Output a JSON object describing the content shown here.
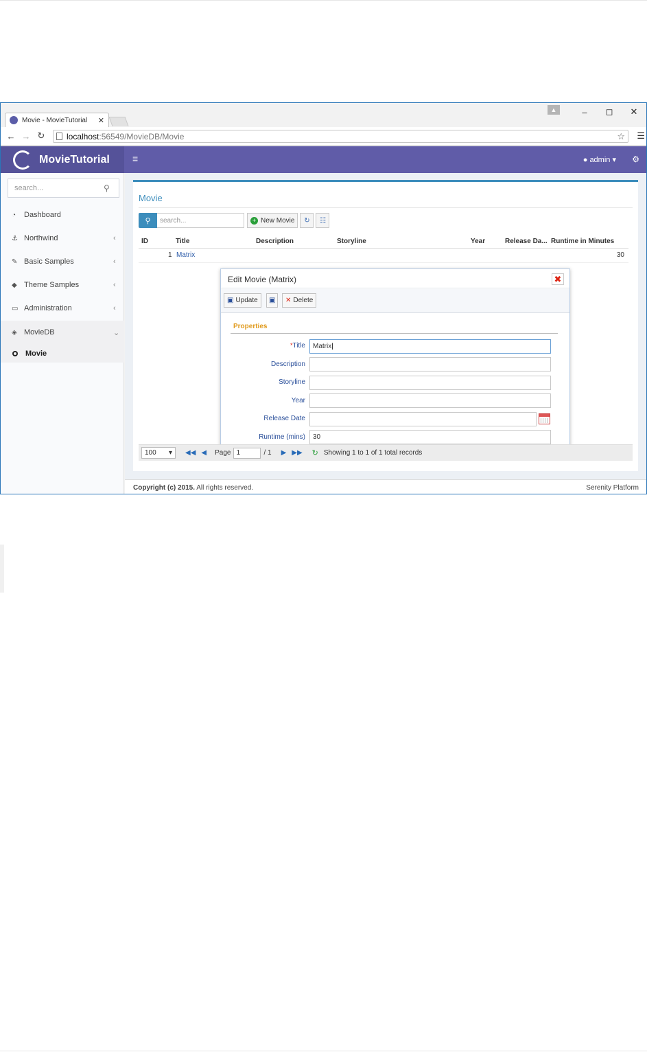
{
  "browser": {
    "tab_title": "Movie - MovieTutorial",
    "url_host": "localhost",
    "url_path": ":56549/MovieDB/Movie"
  },
  "header": {
    "app_name": "MovieTutorial",
    "user": "admin"
  },
  "sidebar": {
    "search_placeholder": "search...",
    "items": [
      {
        "label": "Dashboard",
        "icon": "dashboard-icon"
      },
      {
        "label": "Northwind",
        "icon": "anchor-icon"
      },
      {
        "label": "Basic Samples",
        "icon": "wrench-icon"
      },
      {
        "label": "Theme Samples",
        "icon": "diamond-icon"
      },
      {
        "label": "Administration",
        "icon": "monitor-icon"
      },
      {
        "label": "MovieDB",
        "icon": "cubes-icon"
      }
    ],
    "sub_item": "Movie"
  },
  "grid": {
    "title": "Movie",
    "search_placeholder": "search...",
    "new_button": "New Movie",
    "columns": [
      "ID",
      "Title",
      "Description",
      "Storyline",
      "Year",
      "Release Da...",
      "Runtime in Minutes"
    ],
    "rows": [
      {
        "id": "1",
        "title": "Matrix",
        "description": "",
        "storyline": "",
        "year": "",
        "release_date": "",
        "runtime": "30"
      }
    ],
    "pager": {
      "page_size": "100",
      "page_label": "Page",
      "page_value": "1",
      "page_total": "/ 1",
      "status": "Showing 1 to 1 of 1 total records"
    }
  },
  "dialog": {
    "title": "Edit Movie (Matrix)",
    "update_label": "Update",
    "delete_label": "Delete",
    "category": "Properties",
    "fields": [
      {
        "label": "Title",
        "value": "Matrix",
        "required": "*"
      },
      {
        "label": "Description",
        "value": ""
      },
      {
        "label": "Storyline",
        "value": ""
      },
      {
        "label": "Year",
        "value": ""
      },
      {
        "label": "Release Date",
        "value": ""
      },
      {
        "label": "Runtime (mins)",
        "value": "30"
      }
    ]
  },
  "footer": {
    "copyright_bold": "Copyright (c) 2015.",
    "copyright_rest": " All rights reserved.",
    "platform": "Serenity Platform"
  },
  "colors": {
    "header": "#605ca8",
    "accent": "#3c8dbc",
    "category": "#e09a1c"
  }
}
